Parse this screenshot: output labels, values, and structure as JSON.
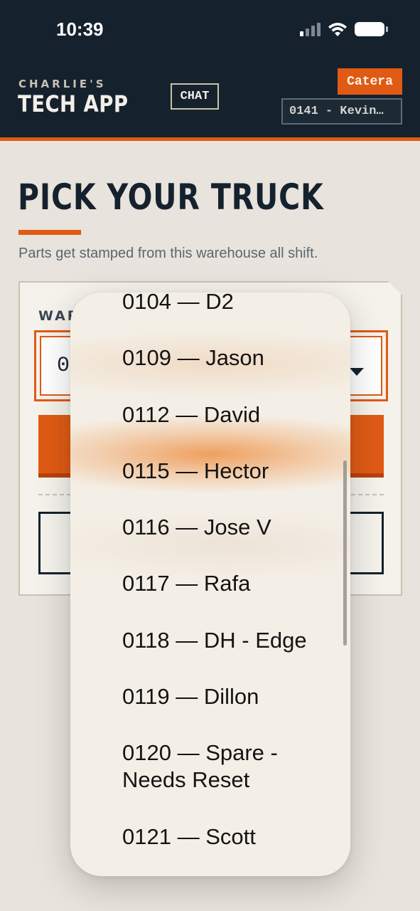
{
  "status_bar": {
    "time": "10:39"
  },
  "header": {
    "brand_small": "CHARLIE'S",
    "brand_big": "TECH APP",
    "chat_label": "CHAT",
    "catera_label": "Catera",
    "truck_chip": "0141 - Kevin…"
  },
  "page": {
    "title": "PICK YOUR TRUCK",
    "subtitle": "Parts get stamped from this warehouse all shift."
  },
  "form": {
    "field_label_visible": "WARE",
    "select_value_visible": "0"
  },
  "picker": {
    "options": [
      "0104 — D2",
      "0109 — Jason",
      "0112 — David",
      "0115 — Hector",
      "0116 — Jose V",
      "0117 — Rafa",
      "0118 — DH - Edge",
      "0119 — Dillon",
      "0120 — Spare - Needs Reset",
      "0121 — Scott"
    ]
  },
  "colors": {
    "header_bg": "#15222e",
    "accent": "#e05a14",
    "page_bg": "#e8e3dc",
    "card_bg": "#f5f2ec"
  }
}
